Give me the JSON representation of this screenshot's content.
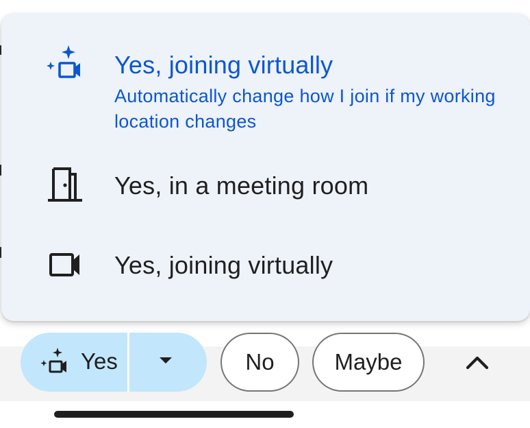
{
  "menu": {
    "items": [
      {
        "title": "Yes, joining virtually",
        "subtitle": "Automatically change how I join if my working location changes",
        "icon": "auto-join-virtual-icon",
        "selected": true
      },
      {
        "title": "Yes, in a meeting room",
        "icon": "meeting-room-door-icon",
        "selected": false
      },
      {
        "title": "Yes, joining virtually",
        "icon": "videocam-icon",
        "selected": false
      }
    ]
  },
  "rsvp": {
    "yes_label": "Yes",
    "yes_icon": "auto-join-virtual-icon",
    "dropdown_icon": "caret-down-icon",
    "no_label": "No",
    "maybe_label": "Maybe",
    "collapse_icon": "chevron-up-icon"
  },
  "colors": {
    "accent": "#0b57d0",
    "menu_bg": "#eef2f9",
    "yes_button_bg": "#c2e6fb",
    "text": "#1f1f1f",
    "outline": "#757575"
  }
}
